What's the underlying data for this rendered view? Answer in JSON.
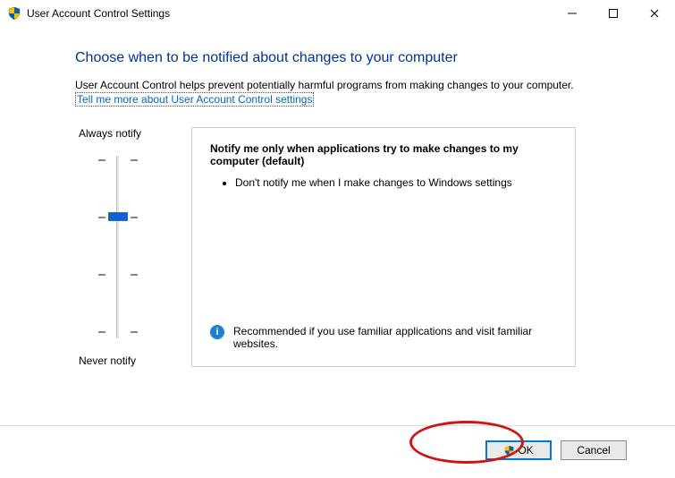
{
  "titlebar": {
    "title": "User Account Control Settings"
  },
  "heading": "Choose when to be notified about changes to your computer",
  "subtext": "User Account Control helps prevent potentially harmful programs from making changes to your computer.",
  "helplink": "Tell me more about User Account Control settings",
  "slider": {
    "top_label": "Always notify",
    "bottom_label": "Never notify",
    "levels": 4,
    "selected_index": 1
  },
  "panel": {
    "title": "Notify me only when applications try to make changes to my computer (default)",
    "bullets": [
      "Don't notify me when I make changes to Windows settings"
    ],
    "recommendation": "Recommended if you use familiar applications and visit familiar websites."
  },
  "footer": {
    "ok_label": "OK",
    "cancel_label": "Cancel"
  }
}
